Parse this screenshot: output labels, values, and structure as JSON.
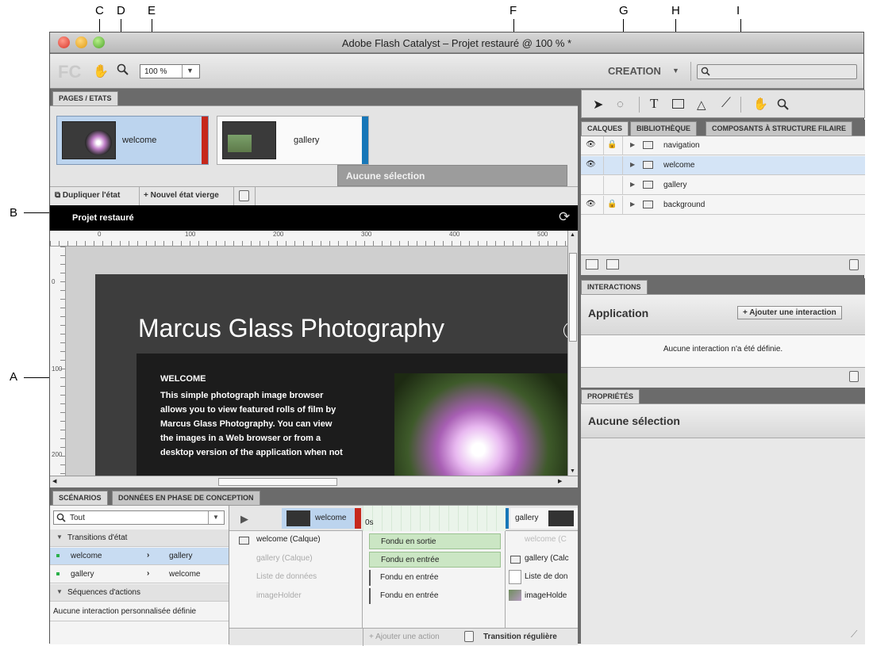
{
  "callouts": {
    "a": "A",
    "b": "B",
    "c": "C",
    "d": "D",
    "e": "E",
    "f": "F",
    "g": "G",
    "h": "H",
    "i": "I"
  },
  "window": {
    "title": "Adobe Flash Catalyst – Projet restauré @ 100 % *"
  },
  "toolbar": {
    "logo": "FC",
    "zoom": "100 %",
    "workspace": "CREATION",
    "search_placeholder": ""
  },
  "pages": {
    "tab": "PAGES / ETATS",
    "items": [
      {
        "label": "welcome"
      },
      {
        "label": "gallery"
      }
    ],
    "no_selection": "Aucune sélection",
    "duplicate": "Dupliquer l'état",
    "new_state": "Nouvel état vierge"
  },
  "stage": {
    "project": "Projet restauré",
    "ruler_h": [
      "0",
      "100",
      "200",
      "300",
      "400",
      "500"
    ],
    "ruler_v": [
      "0",
      "100",
      "200"
    ],
    "site_title": "Marcus Glass Photography",
    "welcome_heading": "WELCOME",
    "welcome_lines": [
      "This simple photograph image browser",
      "allows you to view featured rolls of film by",
      "Marcus Glass Photography. You can view",
      "the images in a Web browser or from a",
      "desktop version of the application when not"
    ]
  },
  "tools": {
    "text_tool": "T"
  },
  "layers": {
    "tabs": [
      "CALQUES",
      "BIBLIOTHÈQUE",
      "COMPOSANTS À STRUCTURE FILAIRE"
    ],
    "items": [
      {
        "label": "navigation"
      },
      {
        "label": "welcome"
      },
      {
        "label": "gallery"
      },
      {
        "label": "background"
      }
    ]
  },
  "interactions": {
    "tab": "INTERACTIONS",
    "heading": "Application",
    "add": "Ajouter une interaction",
    "empty": "Aucune interaction n'a été définie."
  },
  "properties": {
    "tab": "PROPRIÉTÉS",
    "heading": "Aucune sélection"
  },
  "timeline": {
    "tabs": [
      "SCÉNARIOS",
      "DONNÉES EN PHASE DE CONCEPTION"
    ],
    "filter": "Tout",
    "state_transitions": "Transitions d'état",
    "transitions": [
      {
        "from": "welcome",
        "to": "gallery"
      },
      {
        "from": "gallery",
        "to": "welcome"
      }
    ],
    "action_sequences": "Séquences d'actions",
    "no_custom": "Aucune interaction personnalisée définie",
    "from_state": "welcome",
    "to_state": "gallery",
    "time_zero": "0s",
    "left_objects": [
      "welcome (Calque)",
      "gallery (Calque)",
      "Liste de données",
      "imageHolder"
    ],
    "actions": [
      "Fondu en sortie",
      "Fondu en entrée",
      "Fondu en entrée",
      "Fondu en entrée"
    ],
    "right_objects": [
      "welcome (C",
      "gallery (Calc",
      "Liste de don",
      "imageHolde"
    ],
    "add_action": "Ajouter une action",
    "smooth": "Transition régulière"
  }
}
